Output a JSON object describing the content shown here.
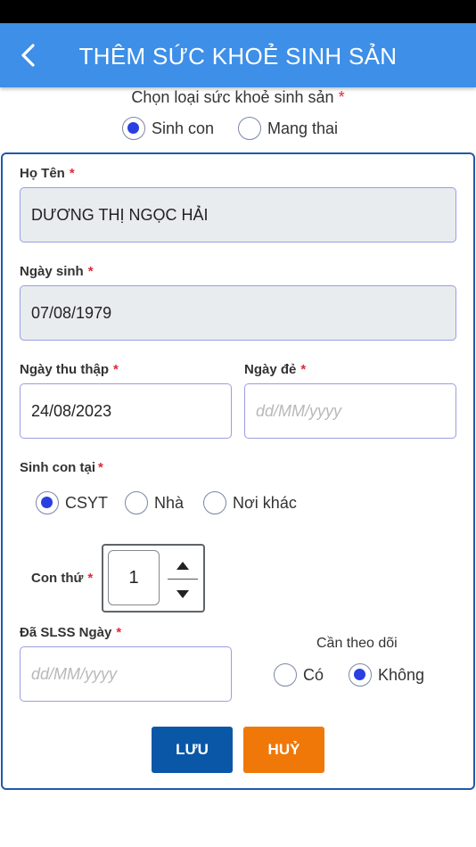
{
  "header": {
    "title": "THÊM SỨC KHOẺ SINH SẢN",
    "back_icon": "chevron-left-icon"
  },
  "type_select": {
    "label": "Chọn loại sức khoẻ sinh sản",
    "required_mark": "*",
    "options": [
      {
        "label": "Sinh con",
        "selected": true
      },
      {
        "label": "Mang thai",
        "selected": false
      }
    ]
  },
  "form": {
    "full_name": {
      "label": "Họ Tên",
      "required_mark": "*",
      "value": "DƯƠNG THỊ NGỌC HẢI",
      "readonly": true
    },
    "birth_date": {
      "label": "Ngày sinh",
      "required_mark": "*",
      "value": "07/08/1979",
      "readonly": true
    },
    "collect_date": {
      "label": "Ngày thu thập",
      "required_mark": "*",
      "value": "24/08/2023"
    },
    "delivery_date": {
      "label": "Ngày đẻ",
      "required_mark": "*",
      "value": "",
      "placeholder": "dd/MM/yyyy"
    },
    "birth_place": {
      "label": "Sinh con tại",
      "required_mark": "*",
      "options": [
        {
          "label": "CSYT",
          "selected": true
        },
        {
          "label": "Nhà",
          "selected": false
        },
        {
          "label": "Nơi khác",
          "selected": false
        }
      ]
    },
    "child_order": {
      "label": "Con thứ",
      "required_mark": "*",
      "value": "1"
    },
    "slss_date": {
      "label": "Đã SLSS Ngày",
      "required_mark": "*",
      "value": "",
      "placeholder": "dd/MM/yyyy"
    },
    "follow_up": {
      "label": "Cần theo dõi",
      "options": [
        {
          "label": "Có",
          "selected": false
        },
        {
          "label": "Không",
          "selected": true
        }
      ]
    }
  },
  "actions": {
    "save_label": "LƯU",
    "cancel_label": "HUỶ"
  },
  "colors": {
    "app_bar": "#3d8fe8",
    "card_border": "#1f5aa8",
    "save_button": "#0a57a8",
    "cancel_button": "#f07808",
    "radio_selected": "#2a3fe0",
    "required": "#e0283a"
  }
}
